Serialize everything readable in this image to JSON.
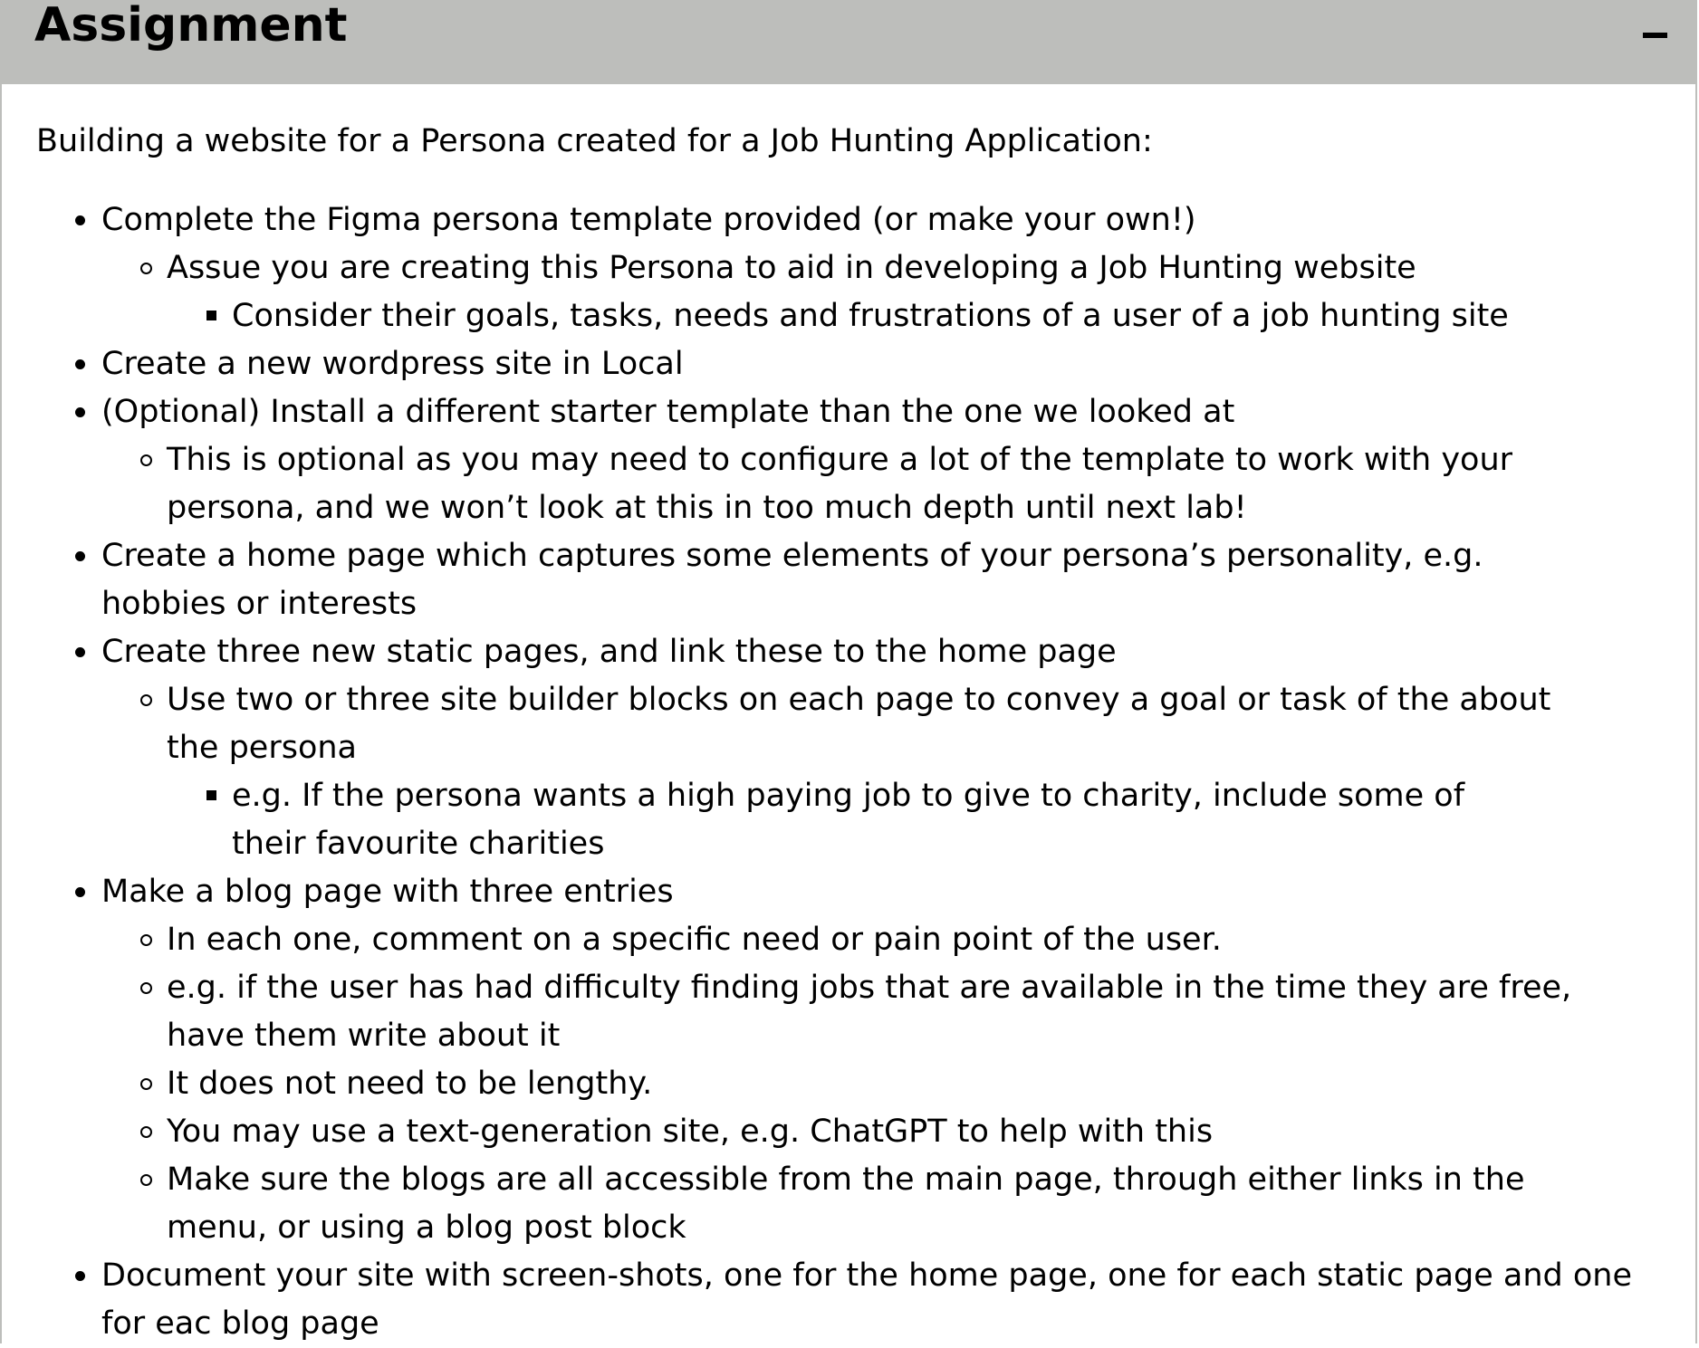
{
  "header": {
    "title": "Assignment",
    "collapse_icon": "minus-icon",
    "background": "#bdbebb"
  },
  "intro": "Building a website for a Persona created for a Job Hunting Application:",
  "items": [
    {
      "text": "Complete the Figma persona template provided (or make your own!)",
      "children": [
        {
          "text": "Assue you are creating this Persona to aid in developing a Job Hunting website",
          "children": [
            {
              "text": "Consider their goals, tasks, needs and frustrations of a user of a job hunting site"
            }
          ]
        }
      ]
    },
    {
      "text": "Create a new wordpress site in Local"
    },
    {
      "text": "(Optional) Install a different starter template than the one we looked at",
      "children": [
        {
          "text": "This is optional as you may need to configure a lot of the template to work with your persona, and we won’t look at this in too much depth until next lab!"
        }
      ]
    },
    {
      "text": "Create a home page which captures some elements of your persona’s personality, e.g. hobbies or interests"
    },
    {
      "text": "Create three new static pages, and link these to the home page",
      "children": [
        {
          "text": "Use two or three site builder blocks on each page to convey a goal or task of the about the persona",
          "children": [
            {
              "text": "e.g. If the persona wants a high paying job to give to charity, include some of their favourite charities"
            }
          ]
        }
      ]
    },
    {
      "text": "Make a blog page with three entries",
      "children": [
        {
          "text": "In each one, comment on a specific need or pain point of the user."
        },
        {
          "text": "e.g. if the user has had difficulty finding jobs that are available in the time they are free, have them write about it"
        },
        {
          "text": "It does not need to be lengthy."
        },
        {
          "text": "You may use a text-generation site, e.g. ChatGPT to help with this"
        },
        {
          "text": "Make sure the blogs are all accessible from the main page, through either links in the menu, or using a blog post block"
        }
      ]
    },
    {
      "text": "Document your site with screen-shots, one for the home page, one for each static page and one for eac blog page"
    }
  ]
}
